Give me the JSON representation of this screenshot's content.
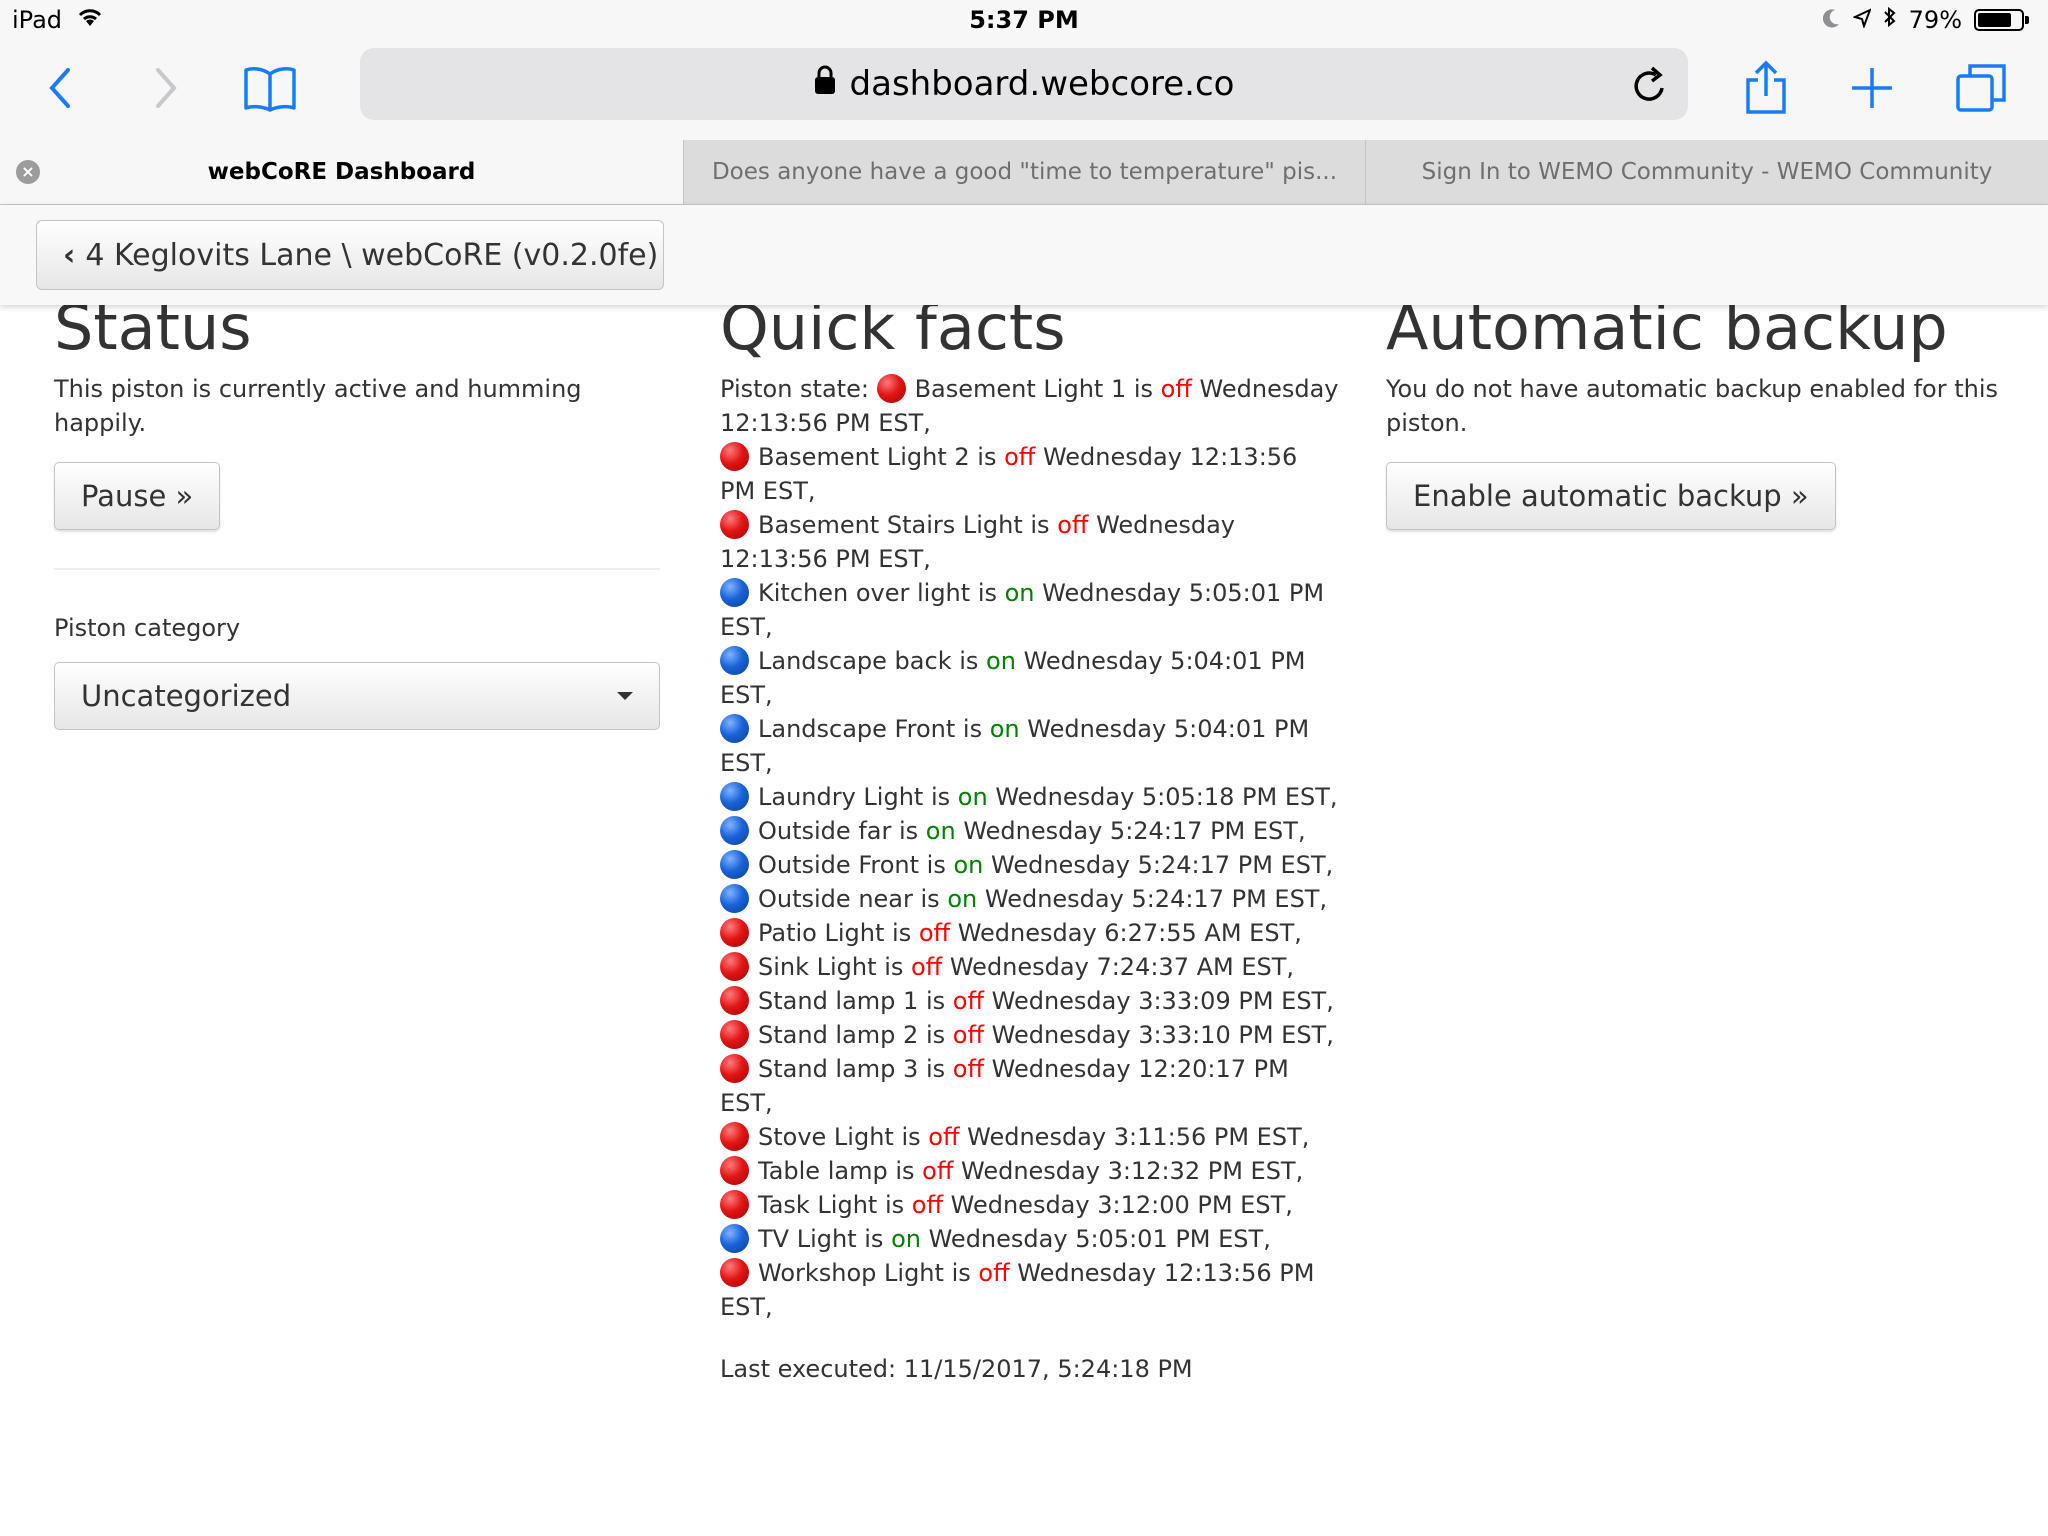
{
  "status_bar": {
    "device": "iPad",
    "time": "5:37 PM",
    "battery": "79%",
    "battery_level": 0.79
  },
  "browser": {
    "url": "dashboard.webcore.co",
    "tabs": [
      {
        "title": "webCoRE Dashboard",
        "active": true
      },
      {
        "title": "Does anyone have a good \"time to temperature\" pis...",
        "active": false
      },
      {
        "title": "Sign In to WEMO Community - WEMO Community",
        "active": false
      }
    ]
  },
  "header": {
    "breadcrumb": "4 Keglovits Lane \\ webCoRE (v0.2.0fe)"
  },
  "status": {
    "title": "Status",
    "text": "This piston is currently active and humming happily.",
    "pause_label": "Pause »",
    "category_label": "Piston category",
    "category_value": "Uncategorized"
  },
  "quick_facts": {
    "title": "Quick facts",
    "state_label": "Piston state:",
    "items": [
      {
        "color": "red",
        "name": "Basement Light 1",
        "is": "is",
        "state": "off",
        "time": "Wednesday 12:13:56 PM EST,"
      },
      {
        "color": "red",
        "name": "Basement Light 2",
        "is": "is",
        "state": "off",
        "time": "Wednesday 12:13:56 PM EST,"
      },
      {
        "color": "red",
        "name": "Basement Stairs Light",
        "is": "is",
        "state": "off",
        "time": "Wednesday 12:13:56 PM EST,"
      },
      {
        "color": "blue",
        "name": "Kitchen over light",
        "is": "is",
        "state": "on",
        "time": "Wednesday 5:05:01 PM EST,"
      },
      {
        "color": "blue",
        "name": "Landscape back",
        "is": "is",
        "state": "on",
        "time": "Wednesday 5:04:01 PM EST,"
      },
      {
        "color": "blue",
        "name": "Landscape Front",
        "is": "is",
        "state": "on",
        "time": "Wednesday 5:04:01 PM EST,"
      },
      {
        "color": "blue",
        "name": "Laundry Light",
        "is": "is",
        "state": "on",
        "time": "Wednesday 5:05:18 PM EST,"
      },
      {
        "color": "blue",
        "name": "Outside far",
        "is": "is",
        "state": "on",
        "time": "Wednesday 5:24:17 PM EST,"
      },
      {
        "color": "blue",
        "name": "Outside Front",
        "is": "is",
        "state": "on",
        "time": "Wednesday 5:24:17 PM EST,"
      },
      {
        "color": "blue",
        "name": "Outside near",
        "is": "is",
        "state": "on",
        "time": "Wednesday 5:24:17 PM EST,"
      },
      {
        "color": "red",
        "name": "Patio Light",
        "is": "is",
        "state": "off",
        "time": "Wednesday 6:27:55 AM EST,"
      },
      {
        "color": "red",
        "name": "Sink Light",
        "is": "is",
        "state": "off",
        "time": "Wednesday 7:24:37 AM EST,"
      },
      {
        "color": "red",
        "name": "Stand lamp 1",
        "is": "is",
        "state": "off",
        "time": "Wednesday 3:33:09 PM EST,"
      },
      {
        "color": "red",
        "name": "Stand lamp 2",
        "is": "is",
        "state": "off",
        "time": "Wednesday 3:33:10 PM EST,"
      },
      {
        "color": "red",
        "name": "Stand lamp 3",
        "is": "is",
        "state": "off",
        "time": "Wednesday 12:20:17 PM EST,"
      },
      {
        "color": "red",
        "name": "Stove Light",
        "is": "is",
        "state": "off",
        "time": "Wednesday 3:11:56 PM EST,"
      },
      {
        "color": "red",
        "name": "Table lamp",
        "is": "is",
        "state": "off",
        "time": "Wednesday 3:12:32 PM EST,"
      },
      {
        "color": "red",
        "name": "Task Light",
        "is": "is",
        "state": "off",
        "time": "Wednesday 3:12:00 PM EST,"
      },
      {
        "color": "blue",
        "name": "TV Light",
        "is": "is",
        "state": "on",
        "time": "Wednesday 5:05:01 PM EST,"
      },
      {
        "color": "red",
        "name": "Workshop Light",
        "is": "is",
        "state": "off",
        "time": "Wednesday 12:13:56 PM EST,"
      }
    ],
    "last_executed": "Last executed: 11/15/2017, 5:24:18 PM"
  },
  "backup": {
    "title": "Automatic backup",
    "text": "You do not have automatic backup enabled for this piston.",
    "button_label": "Enable automatic backup »"
  },
  "colors": {
    "ios_blue": "#1a7cf5",
    "state_on": "#008000",
    "state_off": "#ff0000",
    "dot_red": "#e21616",
    "dot_blue": "#1a63d8"
  },
  "icons": [
    "wifi-icon",
    "moon-icon",
    "location-arrow-icon",
    "bluetooth-icon",
    "battery-icon",
    "back-icon",
    "forward-icon",
    "bookmarks-icon",
    "lock-icon",
    "reload-icon",
    "share-icon",
    "new-tab-icon",
    "tabs-icon",
    "tab-close-icon",
    "chevron-left-icon"
  ]
}
